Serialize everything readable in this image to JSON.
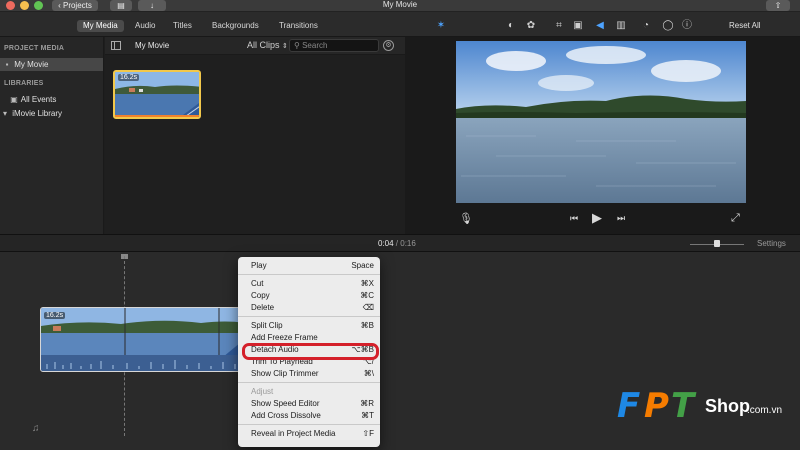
{
  "window": {
    "title": "My Movie",
    "projects_label": "Projects"
  },
  "media_tabs": [
    "My Media",
    "Audio",
    "Titles",
    "Backgrounds",
    "Transitions"
  ],
  "viewer_toolbar": {
    "reset_label": "Reset All",
    "icons": [
      "magic-wand",
      "color-balance",
      "color-palette",
      "crop",
      "stabilization",
      "volume",
      "equalizer",
      "speed",
      "noise-filter",
      "info"
    ]
  },
  "sidebar": {
    "project_media_header": "PROJECT MEDIA",
    "project_item": "My Movie",
    "libraries_header": "LIBRARIES",
    "all_events": "All Events",
    "library": "iMovie Library"
  },
  "browser": {
    "title": "My Movie",
    "filter": "All Clips",
    "search_placeholder": "Search",
    "clip_duration": "16.2s"
  },
  "timeline": {
    "current_time": "0:04",
    "separator": " / ",
    "total_time": "0:16",
    "settings_label": "Settings",
    "clip_duration": "16.2s"
  },
  "context_menu": {
    "groups": [
      [
        {
          "label": "Play",
          "shortcut": "Space"
        }
      ],
      [
        {
          "label": "Cut",
          "shortcut": "⌘X"
        },
        {
          "label": "Copy",
          "shortcut": "⌘C"
        },
        {
          "label": "Delete",
          "shortcut": "⌫"
        }
      ],
      [
        {
          "label": "Split Clip",
          "shortcut": "⌘B"
        },
        {
          "label": "Add Freeze Frame",
          "shortcut": ""
        },
        {
          "label": "Detach Audio",
          "shortcut": "⌥⌘B"
        },
        {
          "label": "Trim To Playhead",
          "shortcut": "⌥/"
        },
        {
          "label": "Show Clip Trimmer",
          "shortcut": "⌘\\"
        }
      ],
      [
        {
          "label": "Adjust",
          "shortcut": "",
          "disabled": true
        },
        {
          "label": "Show Speed Editor",
          "shortcut": "⌘R"
        },
        {
          "label": "Add Cross Dissolve",
          "shortcut": "⌘T"
        }
      ],
      [
        {
          "label": "Reveal in Project Media",
          "shortcut": "⇧F"
        }
      ]
    ],
    "highlighted_item": "Detach Audio",
    "highlight_color": "#d4202a"
  },
  "watermark": {
    "letters": [
      "F",
      "P",
      "T"
    ],
    "letter_colors": [
      "#1e88e5",
      "#f57c00",
      "#43a047"
    ],
    "shop": "Shop",
    "domain": ".com.vn"
  }
}
